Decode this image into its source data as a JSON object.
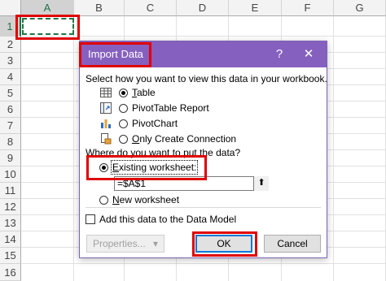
{
  "sheet": {
    "columns": [
      "A",
      "B",
      "C",
      "D",
      "E",
      "F",
      "G"
    ],
    "rows": [
      "1",
      "2",
      "3",
      "4",
      "5",
      "6",
      "7",
      "8",
      "9",
      "10",
      "11",
      "12",
      "13",
      "14",
      "15",
      "16"
    ],
    "active_column": "A",
    "active_row": "1"
  },
  "dialog": {
    "title": "Import Data",
    "help_glyph": "?",
    "close_glyph": "✕",
    "view_prompt": "Select how you want to view this data in your workbook.",
    "view_options": [
      {
        "label": "Table",
        "accel": "T",
        "rest": "able",
        "checked": true,
        "icon": "table-icon"
      },
      {
        "label": "PivotTable Report",
        "accel": "",
        "rest": "PivotTable Report",
        "checked": false,
        "icon": "pivottable-icon"
      },
      {
        "label": "PivotChart",
        "accel": "",
        "rest": "PivotChart",
        "checked": false,
        "icon": "pivotchart-icon"
      },
      {
        "label": "Only Create Connection",
        "accel": "O",
        "rest": "nly Create Connection",
        "checked": false,
        "icon": "connection-icon"
      }
    ],
    "put_prompt": "Where do you want to put the data?",
    "existing_label_accel": "E",
    "existing_label_rest": "xisting worksheet:",
    "existing_checked": true,
    "cell_ref": "=$A$1",
    "collapse_glyph": "⬆",
    "new_label_accel": "N",
    "new_label_rest": "ew worksheet",
    "data_model_label": "Add this data to the Data Model",
    "properties_label": "Properties...",
    "properties_glyph": "▾",
    "ok_label": "OK",
    "cancel_label": "Cancel"
  },
  "colors": {
    "titlebar": "#8660be",
    "highlight": "#e00000",
    "excel_green": "#217346",
    "focus_blue": "#0078d7"
  }
}
